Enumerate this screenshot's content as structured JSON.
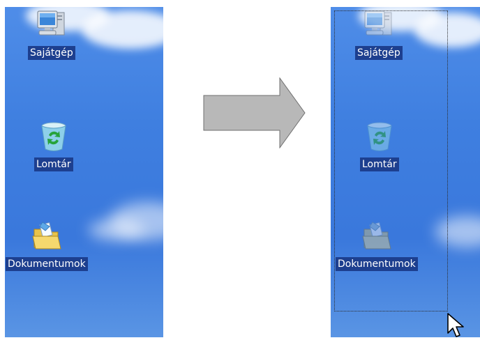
{
  "left_panel": {
    "icons": [
      {
        "label": "Sajátgép",
        "icon": "my-computer-icon"
      },
      {
        "label": "Lomtár",
        "icon": "recycle-bin-icon"
      },
      {
        "label": "Dokumentumok",
        "icon": "my-documents-folder-icon"
      }
    ]
  },
  "right_panel": {
    "icons": [
      {
        "label": "Sajátgép",
        "icon": "my-computer-icon",
        "selected": true
      },
      {
        "label": "Lomtár",
        "icon": "recycle-bin-icon",
        "selected": true
      },
      {
        "label": "Dokumentumok",
        "icon": "my-documents-folder-icon",
        "selected": true
      }
    ]
  },
  "arrow": {
    "icon": "right-arrow-icon",
    "color": "#b8b8b8"
  },
  "cursor": {
    "icon": "mouse-pointer-icon"
  },
  "colors": {
    "desktop_blue": "#3f7fe0",
    "selection_highlight": "#1d3f8f",
    "label_text": "#ffffff"
  }
}
